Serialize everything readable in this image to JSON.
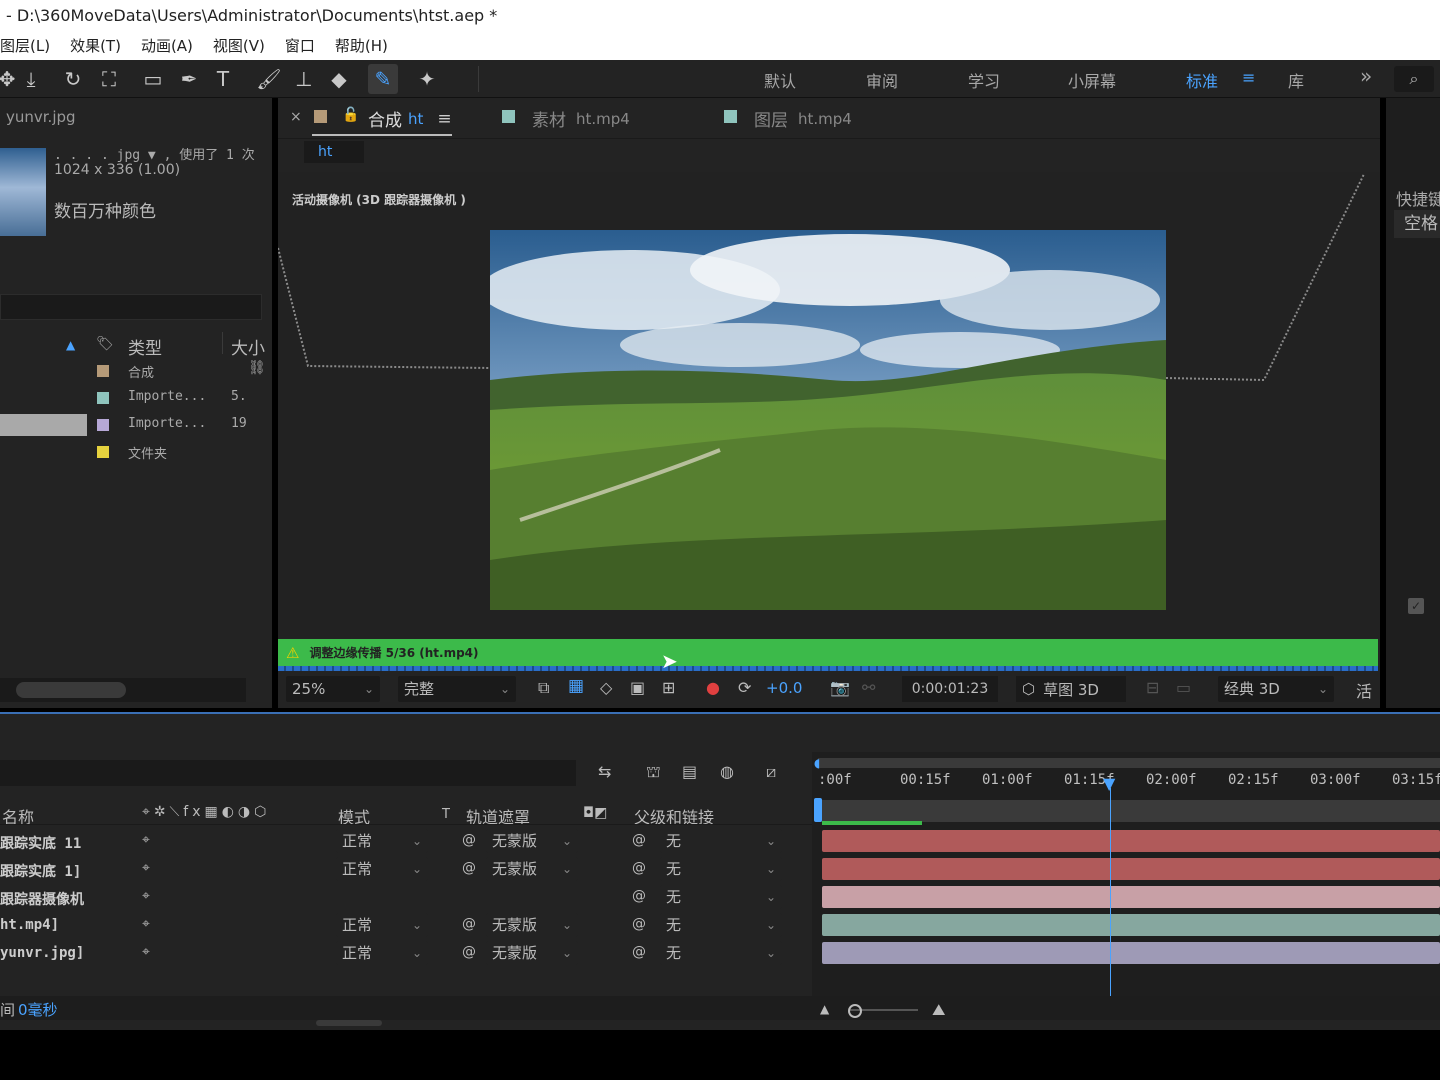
{
  "window": {
    "title": "- D:\\360MoveData\\Users\\Administrator\\Documents\\htst.aep *"
  },
  "menu": [
    "图层(L)",
    "效果(T)",
    "动画(A)",
    "视图(V)",
    "窗口",
    "帮助(H)"
  ],
  "workspaces": {
    "default": "默认",
    "review": "审阅",
    "learn": "学习",
    "small": "小屏幕",
    "standard": "标准",
    "library": "库",
    "more": "»"
  },
  "project": {
    "selected_file": "yunvr.jpg",
    "file_info_line1": ". . . . jpg ▼ , 使用了 1 次",
    "file_info_line2": "1024 x 336 (1.00)",
    "file_info_line3": "数百万种颜色",
    "col_type": "类型",
    "col_size": "大小",
    "items": [
      {
        "type": "合成",
        "size": "",
        "color": "#b59a78"
      },
      {
        "type": "Importe...",
        "size": "5.",
        "color": "#8fc4bd"
      },
      {
        "type": "Importe...",
        "size": "19",
        "color": "#b6a8d6"
      },
      {
        "type": "文件夹",
        "size": "",
        "color": "#e6d23e"
      }
    ]
  },
  "viewer": {
    "tabs": {
      "comp_prefix": "合成",
      "comp_name": "ht",
      "footage_prefix": "素材",
      "footage_name": "ht.mp4",
      "layer_prefix": "图层",
      "layer_name": "ht.mp4"
    },
    "breadcrumb": "ht",
    "camera_label": "活动摄像机 (3D 跟踪器摄像机 )",
    "status_text": "调整边缘传播 5/36 (ht.mp4)",
    "zoom": "25%",
    "resolution": "完整",
    "exposure": "+0.0",
    "timecode": "0:00:01:23",
    "draft3d": "草图 3D",
    "renderer": "经典 3D",
    "more": "活"
  },
  "rightpanel": {
    "shortcut_label": "快捷键",
    "key_label": "空格"
  },
  "timeline": {
    "col_name": "名称",
    "col_mode": "模式",
    "col_t": "T",
    "col_matte": "轨道遮罩",
    "col_parent": "父级和链接",
    "ruler": [
      ":00f",
      "00:15f",
      "01:00f",
      "01:15f",
      "02:00f",
      "02:15f",
      "03:00f",
      "03:15f"
    ],
    "current_time_fraction": 0.47,
    "work_area_fraction": 0.16,
    "layers": [
      {
        "name": "跟踪实底 11",
        "mode": "正常",
        "matte": "无蒙版",
        "parent": "无",
        "bar_color": "#b05a5a"
      },
      {
        "name": "跟踪实底 1]",
        "mode": "正常",
        "matte": "无蒙版",
        "parent": "无",
        "bar_color": "#b05a5a"
      },
      {
        "name": "跟踪器摄像机",
        "mode": "",
        "matte": "",
        "parent": "无",
        "bar_color": "#c8a0a6"
      },
      {
        "name": "ht.mp4]",
        "mode": "正常",
        "matte": "无蒙版",
        "parent": "无",
        "bar_color": "#86a79f"
      },
      {
        "name": "yunvr.jpg]",
        "mode": "正常",
        "matte": "无蒙版",
        "parent": "无",
        "bar_color": "#9e9ab6"
      }
    ],
    "footer_left": "间",
    "footer_time": "0毫秒"
  }
}
